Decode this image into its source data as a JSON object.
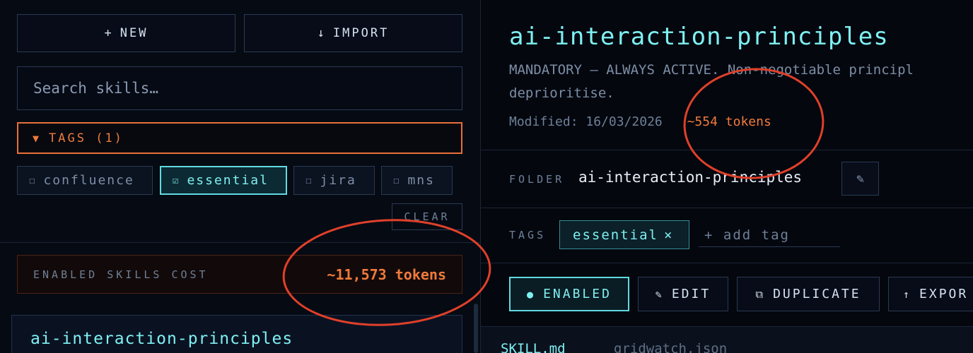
{
  "left": {
    "new_button": {
      "icon": "+",
      "label": "NEW"
    },
    "import_button": {
      "icon": "↓",
      "label": "IMPORT"
    },
    "search": {
      "placeholder": "Search skills…"
    },
    "tags_toggle": {
      "arrow": "▼",
      "label": "TAGS (1)"
    },
    "tag_filters": [
      {
        "box": "☐",
        "label": "confluence",
        "checked": false
      },
      {
        "box": "☑",
        "label": "essential",
        "checked": true
      },
      {
        "box": "☐",
        "label": "jira",
        "checked": false
      },
      {
        "box": "☐",
        "label": "mns",
        "checked": false
      }
    ],
    "clear_label": "CLEAR",
    "cost": {
      "label": "ENABLED SKILLS COST",
      "value": "~11,573 tokens"
    },
    "skill_list": [
      {
        "name": "ai-interaction-principles"
      }
    ]
  },
  "detail": {
    "title": "ai-interaction-principles",
    "description_line1": "MANDATORY — ALWAYS ACTIVE. Non-negotiable principl",
    "description_line2": "deprioritise.",
    "modified": "Modified: 16/03/2026",
    "tokens": "~554 tokens",
    "folder_label": "FOLDER",
    "folder_value": "ai-interaction-principles",
    "folder_edit_icon": "✎",
    "tags_label": "TAGS",
    "tag": {
      "label": "essential",
      "remove": "×"
    },
    "add_tag_placeholder": "+ add tag",
    "actions": {
      "enabled": {
        "icon": "●",
        "label": "ENABLED"
      },
      "edit": {
        "icon": "✎",
        "label": "EDIT"
      },
      "duplicate": {
        "icon": "⧉",
        "label": "DUPLICATE"
      },
      "export": {
        "icon": "↑",
        "label": "EXPOR"
      }
    },
    "file_tabs": [
      "SKILL.md",
      "gridwatch.json"
    ]
  },
  "colors": {
    "accent_cyan": "#7ff0f2",
    "accent_orange": "#f07a3c",
    "annotation_red": "#e0402a",
    "background": "#05080f"
  },
  "icons": {
    "new": "plus-icon",
    "import": "download-arrow-icon",
    "tags_toggle": "caret-down-icon",
    "checkbox": "checkbox-icon",
    "folder_edit": "pencil-icon",
    "tag_remove": "close-icon",
    "enabled": "dot-icon",
    "edit": "pencil-icon",
    "duplicate": "copy-icon",
    "export": "upload-arrow-icon"
  }
}
